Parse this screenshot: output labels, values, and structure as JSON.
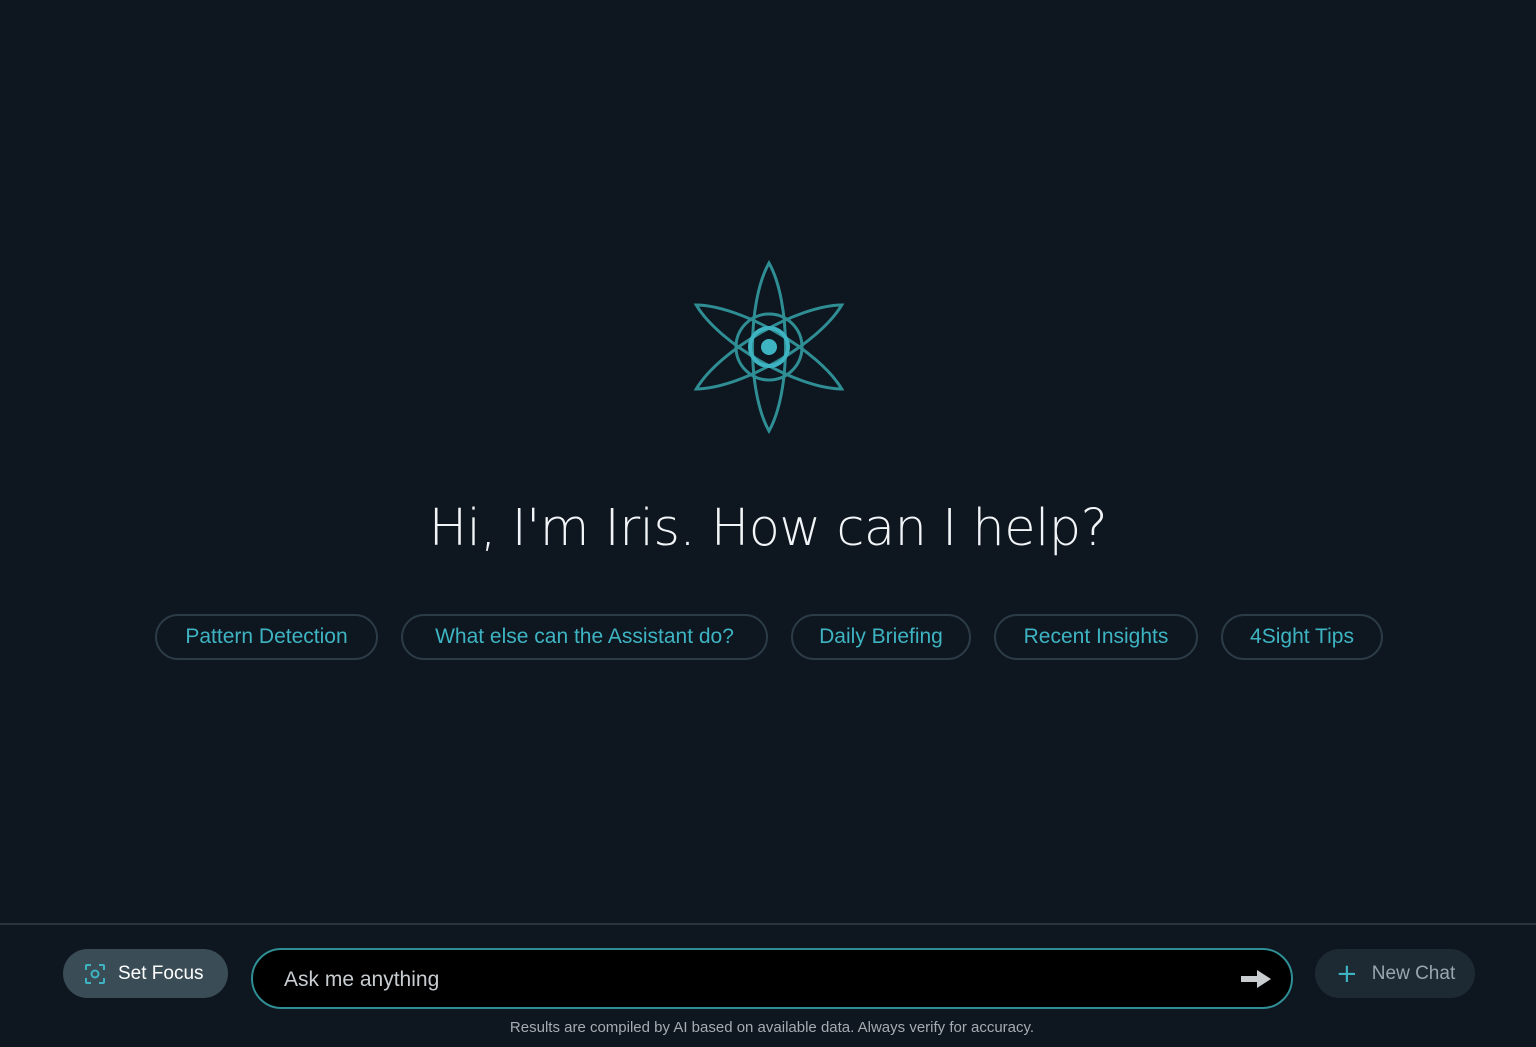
{
  "assistant": {
    "greeting": "Hi, I'm Iris. How can I help?",
    "logo_icon": "atom-flower-icon",
    "accent_color": "#3eb4c2",
    "logo_color": "#2f8e94"
  },
  "suggestions": [
    {
      "label": "Pattern Detection"
    },
    {
      "label": "What else can the Assistant do?"
    },
    {
      "label": "Daily Briefing"
    },
    {
      "label": "Recent Insights"
    },
    {
      "label": "4Sight Tips"
    }
  ],
  "composer": {
    "set_focus_label": "Set Focus",
    "set_focus_icon": "focus-target-icon",
    "placeholder": "Ask me anything",
    "value": "",
    "send_icon": "arrow-right-icon",
    "new_chat_label": "New Chat",
    "new_chat_icon": "plus-icon",
    "disclaimer": "Results are compiled by AI based on available data. Always verify for accuracy."
  }
}
